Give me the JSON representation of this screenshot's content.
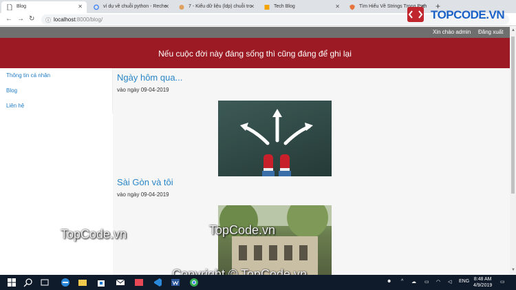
{
  "browser": {
    "tabs": [
      {
        "label": "Blog",
        "active": true
      },
      {
        "label": "ví dụ về chuỗi python - Reche",
        "active": false
      },
      {
        "label": "7 - Kiểu dữ liệu (ldp) chuỗi tro",
        "active": false
      },
      {
        "label": "Tech Blog",
        "active": false
      },
      {
        "label": "Tìm Hiểu Về Strings Trong Pyth",
        "active": false
      }
    ],
    "url_host": "localhost",
    "url_rest": ":8000/blog/"
  },
  "site": {
    "greeting": "Xin chào admin",
    "logout": "Đăng xuất",
    "banner": "Nếu cuộc đời này đáng sống thì cũng đáng để ghi lại",
    "sidebar": [
      {
        "label": "Thông tin cá nhân"
      },
      {
        "label": "Blog"
      },
      {
        "label": "Liên hệ"
      }
    ],
    "posts": [
      {
        "title": "Ngày hôm qua...",
        "date": "vào ngày 09-04-2019"
      },
      {
        "title": "Sài Gòn và tôi",
        "date": "vào ngày 09-04-2019"
      }
    ]
  },
  "taskbar": {
    "lang": "ENG",
    "time": "8:48 AM",
    "date": "4/9/2019"
  },
  "overlay": {
    "logo": "TOPCODE.VN",
    "watermark1": "TopCode.vn",
    "watermark2": "TopCode.vn",
    "watermark3": "Copyright © TopCode.vn"
  },
  "colors": {
    "banner": "#9b1a23",
    "link": "#2a86c7",
    "topnav": "#6f6f6f"
  }
}
